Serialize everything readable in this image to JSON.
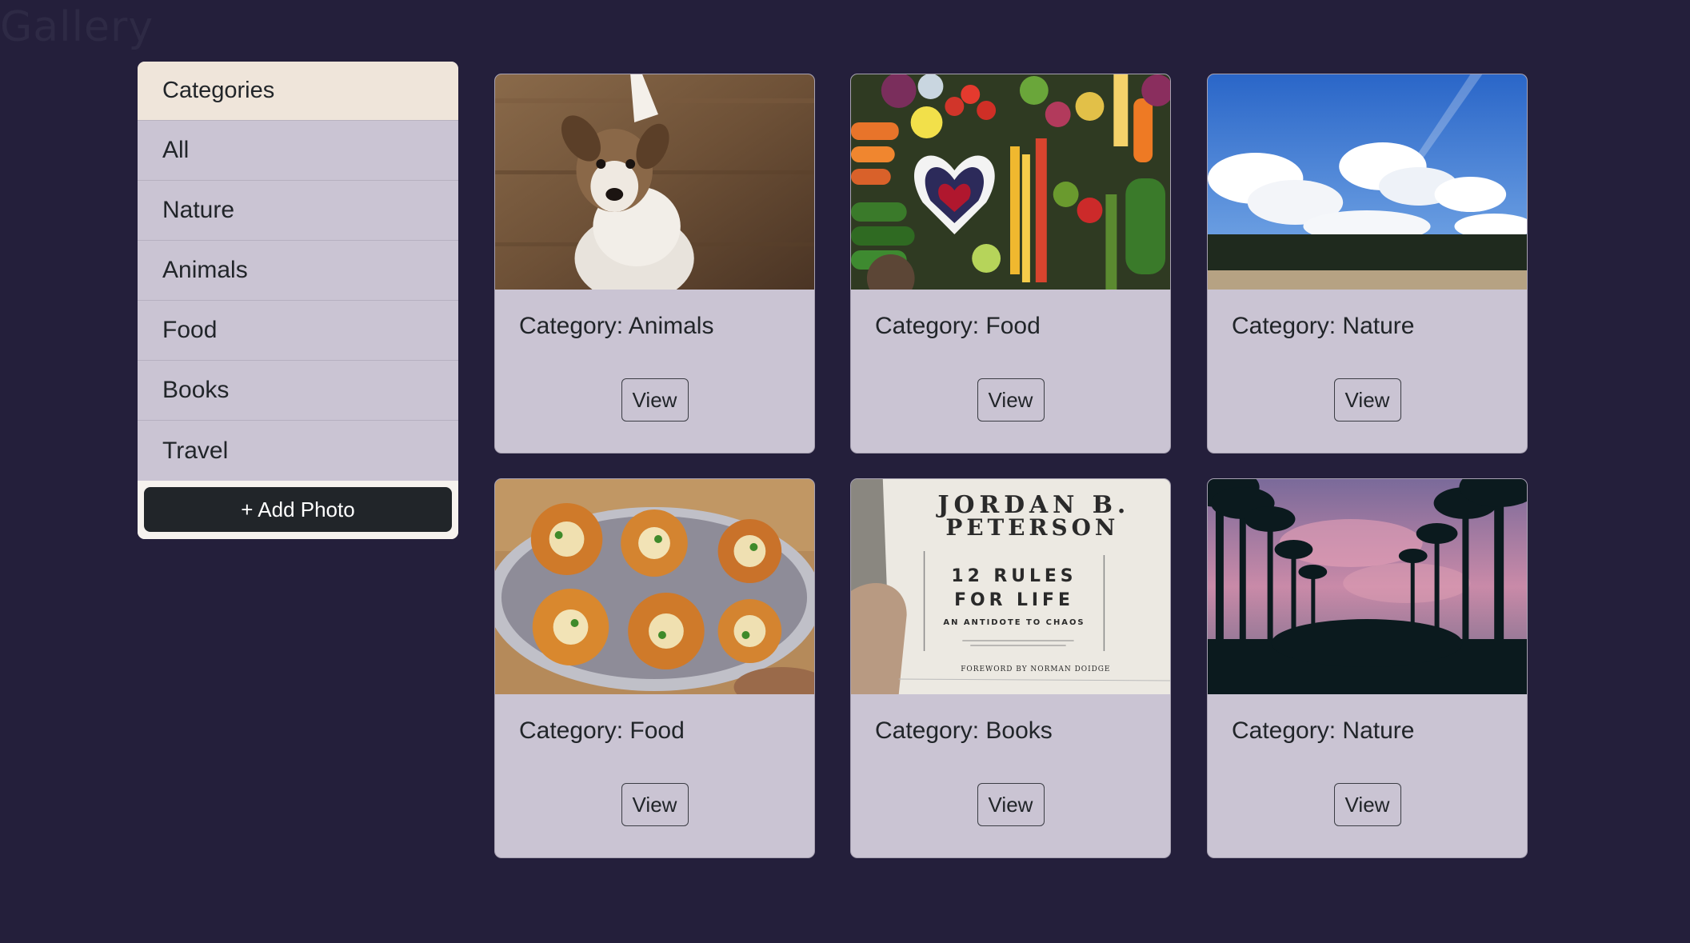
{
  "app": {
    "brand": "Gallery"
  },
  "sidebar": {
    "header": "Categories",
    "items": [
      {
        "label": "All"
      },
      {
        "label": "Nature"
      },
      {
        "label": "Animals"
      },
      {
        "label": "Food"
      },
      {
        "label": "Books"
      },
      {
        "label": "Travel"
      }
    ],
    "add_button": "+ Add Photo"
  },
  "cards": [
    {
      "category": "Category: Animals",
      "button": "View",
      "image": "puppy-photo"
    },
    {
      "category": "Category: Food",
      "button": "View",
      "image": "vegetables-photo"
    },
    {
      "category": "Category: Nature",
      "button": "View",
      "image": "sky-clouds-photo"
    },
    {
      "category": "Category: Food",
      "button": "View",
      "image": "pani-puri-photo"
    },
    {
      "category": "Category: Books",
      "button": "View",
      "image": "book-cover-photo",
      "book": {
        "author_line1": "JORDAN B.",
        "author_line2": "PETERSON",
        "title1": "12 RULES",
        "title2": "FOR LIFE",
        "subtitle": "AN ANTIDOTE TO CHAOS",
        "foreword": "FOREWORD BY NORMAN DOIDGE"
      }
    },
    {
      "category": "Category: Nature",
      "button": "View",
      "image": "palm-trees-photo"
    }
  ],
  "colors": {
    "page_bg": "#241f3b",
    "card_bg": "#cac4d3",
    "sidebar_header_bg": "#efe5da",
    "button_dark": "#212529"
  }
}
